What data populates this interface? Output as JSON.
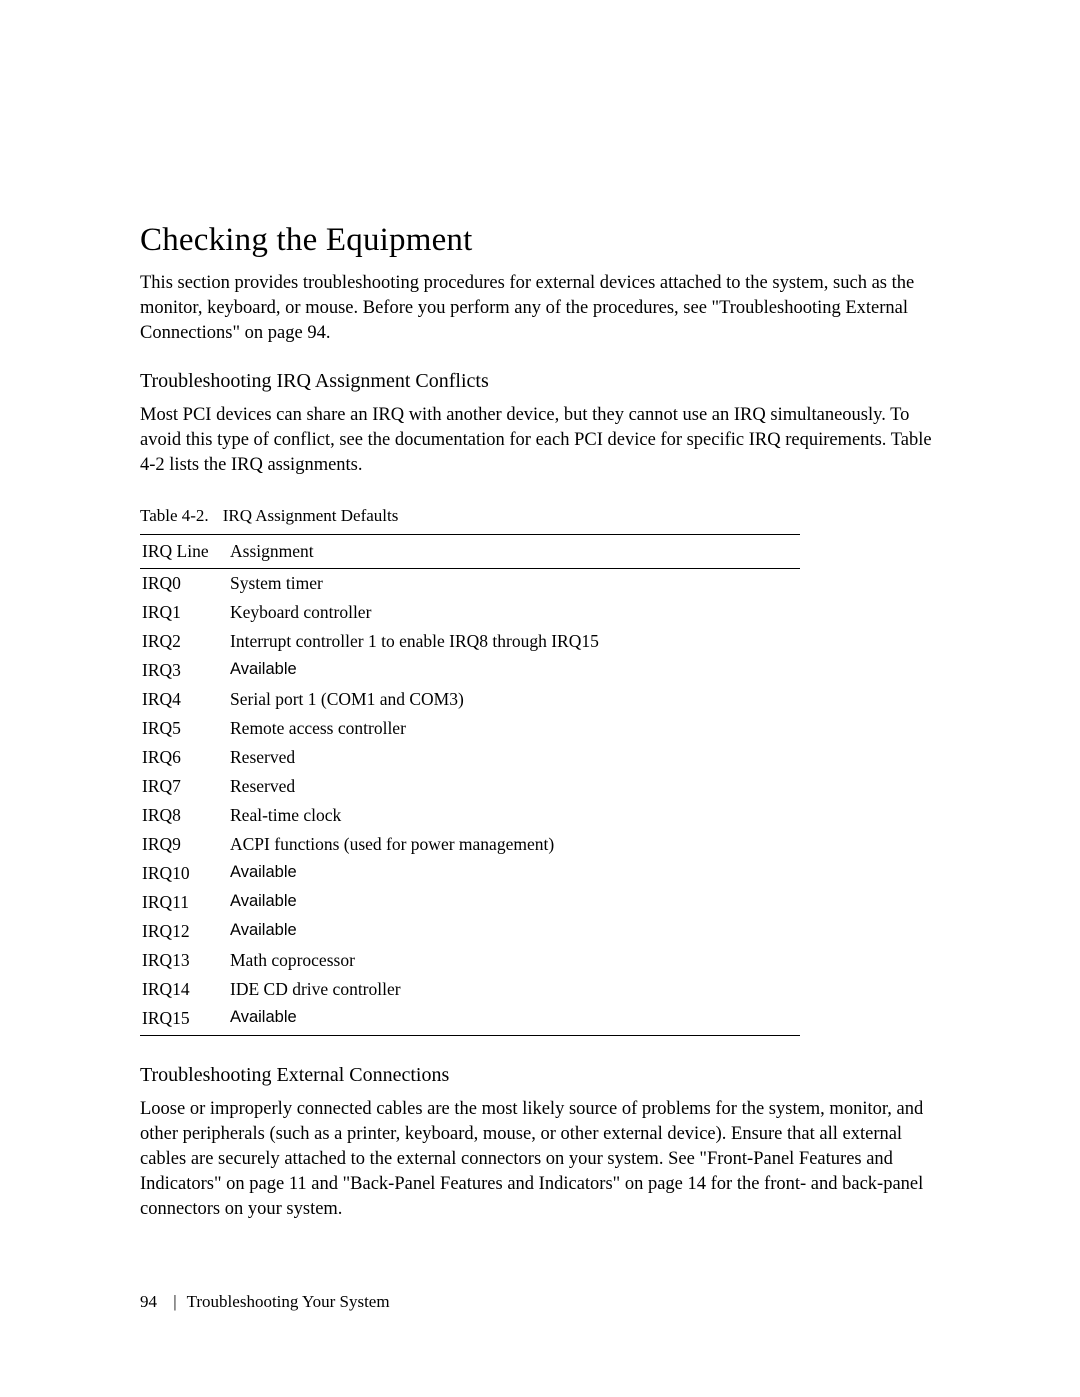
{
  "title": "Checking the Equipment",
  "intro": "This section provides troubleshooting procedures for external devices attached to the system, such as the monitor, keyboard, or mouse. Before you perform any of the procedures, see \"Troubleshooting External Connections\" on page 94.",
  "section_irq": {
    "heading": "Troubleshooting IRQ Assignment Conflicts",
    "para": "Most PCI devices can share an IRQ with another device, but they cannot use an IRQ simultaneously. To avoid this type of conflict, see the documentation for each PCI device for specific IRQ requirements. Table 4-2 lists the IRQ assignments."
  },
  "table": {
    "caption_label": "Table 4-2.",
    "caption_title": "IRQ Assignment Defaults",
    "col1": "IRQ Line",
    "col2": "Assignment",
    "rows": [
      {
        "irq": "IRQ0",
        "desc": "System timer",
        "sans": false
      },
      {
        "irq": "IRQ1",
        "desc": "Keyboard controller",
        "sans": false
      },
      {
        "irq": "IRQ2",
        "desc": "Interrupt controller 1 to enable IRQ8 through IRQ15",
        "sans": false
      },
      {
        "irq": "IRQ3",
        "desc": "Available",
        "sans": true
      },
      {
        "irq": "IRQ4",
        "desc": "Serial port 1 (COM1 and COM3)",
        "sans": false
      },
      {
        "irq": "IRQ5",
        "desc": "Remote access controller",
        "sans": false
      },
      {
        "irq": "IRQ6",
        "desc": "Reserved",
        "sans": false
      },
      {
        "irq": "IRQ7",
        "desc": "Reserved",
        "sans": false
      },
      {
        "irq": "IRQ8",
        "desc": "Real-time clock",
        "sans": false
      },
      {
        "irq": "IRQ9",
        "desc": "ACPI functions (used for power management)",
        "sans": false
      },
      {
        "irq": "IRQ10",
        "desc": "Available",
        "sans": true
      },
      {
        "irq": "IRQ11",
        "desc": "Available",
        "sans": true
      },
      {
        "irq": "IRQ12",
        "desc": "Available",
        "sans": true
      },
      {
        "irq": "IRQ13",
        "desc": "Math coprocessor",
        "sans": false
      },
      {
        "irq": "IRQ14",
        "desc": "IDE CD drive controller",
        "sans": false
      },
      {
        "irq": "IRQ15",
        "desc": "Available",
        "sans": true
      }
    ]
  },
  "section_ext": {
    "heading": "Troubleshooting External Connections",
    "para": "Loose or improperly connected cables are the most likely source of problems for the system, monitor, and other peripherals (such as a printer, keyboard, mouse, or other external device). Ensure that all external cables are securely attached to the external connectors on your system. See \"Front-Panel Features and Indicators\" on page 11 and \"Back-Panel Features and Indicators\" on page 14 for the front- and back-panel connectors on your system."
  },
  "footer": {
    "page": "94",
    "sep": "|",
    "section": "Troubleshooting Your System"
  }
}
